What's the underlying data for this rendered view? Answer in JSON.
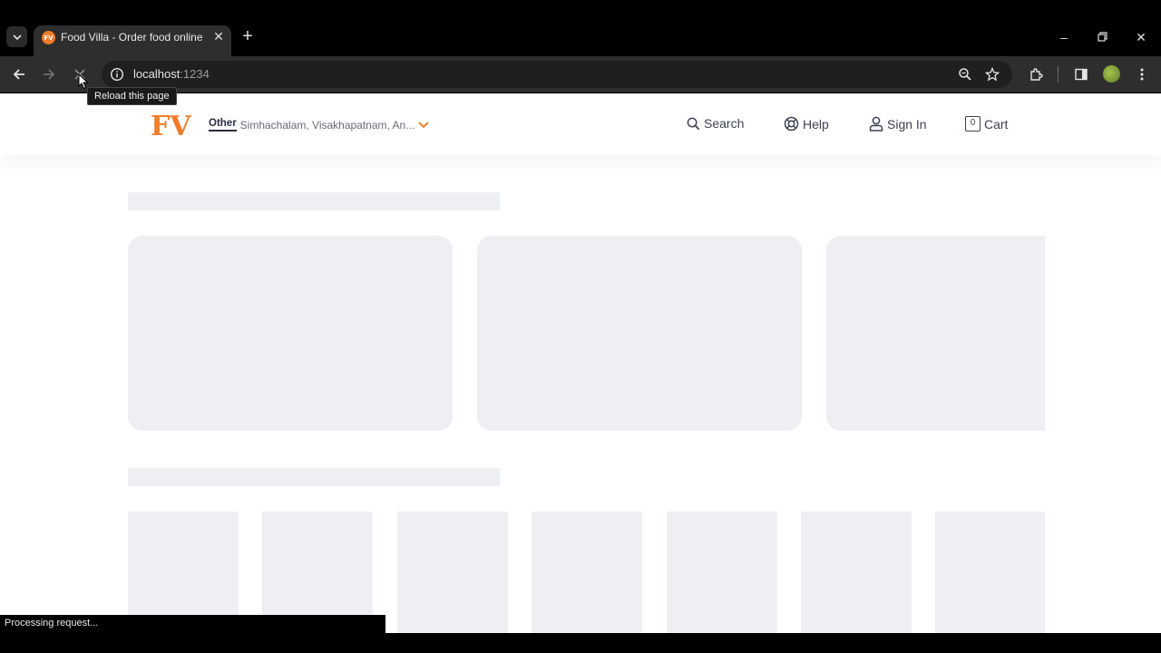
{
  "browser": {
    "tab": {
      "title": "Food Villa - Order food online",
      "favicon_text": "FV"
    },
    "address": {
      "host": "localhost",
      "port": ":1234"
    },
    "tooltip": "Reload this page",
    "status": "Processing request..."
  },
  "header": {
    "logo_text": "FV",
    "location": {
      "type": "Other",
      "address": "Simhachalam, Visakhapatnam, An..."
    },
    "nav": [
      {
        "label": "Search",
        "icon": "search-icon"
      },
      {
        "label": "Help",
        "icon": "help-lifebuoy-icon"
      },
      {
        "label": "Sign In",
        "icon": "user-icon"
      },
      {
        "label": "Cart",
        "icon": "cart-icon",
        "count": "0"
      }
    ]
  },
  "colors": {
    "brand": "#f07d2a",
    "shimmer": "#eeeff2",
    "chrome_dark": "#2e2e2e"
  }
}
